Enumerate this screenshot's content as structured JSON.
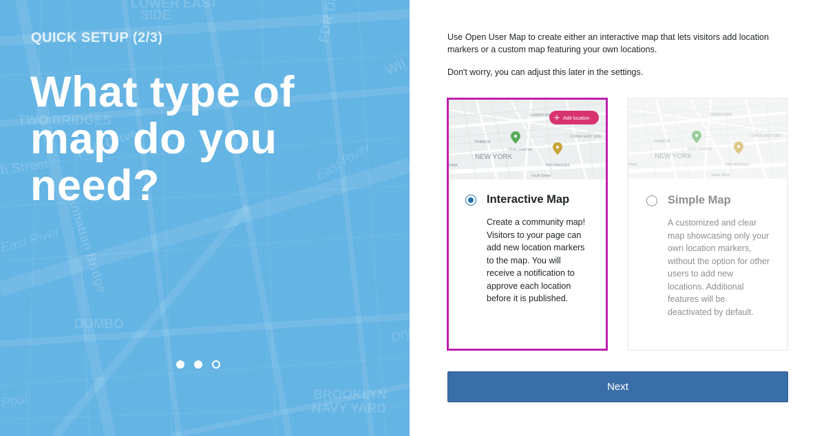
{
  "left_panel": {
    "step": "QUICK SETUP (2/3)",
    "question": "What type of map do you need?",
    "background_labels": [
      "LOWER EAST",
      "SIDE",
      "FDR Drive",
      "Wil",
      "TWO BRIDGES",
      "h Street",
      "FDR Drive",
      "East River",
      "East River",
      "Manhattan Bridge",
      "DUMBO",
      "BROOKLYN",
      "NAVY YARD",
      "Pool",
      "Dry"
    ],
    "pagination": {
      "total": 3,
      "active": 2
    }
  },
  "intro": {
    "line1": "Use Open User Map to create either an interactive map that lets visitors add location markers or a custom map featuring your own locations.",
    "line2": "Don't worry, you can adjust this later in the settings."
  },
  "options": [
    {
      "title": "Interactive Map",
      "description": "Create a community map! Visitors to your page can add new location markers to the map. You will receive a notification to approve each location before it is published.",
      "selected": true,
      "thumbnail": {
        "add_button": "Add location",
        "labels": [
          "TRIBECA",
          "CHINATOWN",
          "LOWER EAST SIDE",
          "CIVIC CENTER",
          "NEW YORK",
          "TWO BRIDGES",
          "PARK",
          "South Street"
        ]
      }
    },
    {
      "title": "Simple Map",
      "description": "A customized and clear map showcasing only your own location markers, without the option for other users to add new locations. Additional features will be deactivated by default.",
      "selected": false,
      "thumbnail": {
        "labels": [
          "TRIBECA",
          "CHINATOWN",
          "LOWER EAST SIDE",
          "CIVIC CENTER",
          "NEW YORK",
          "TWO BRIDGES",
          "PARK",
          "South Street"
        ]
      }
    }
  ],
  "next_label": "Next",
  "colors": {
    "left_bg": "#64b4e4",
    "selected_border": "#c01fae",
    "button_bg": "#3a6ea8",
    "radio_active": "#2271b1",
    "add_button": "#d8336f",
    "pin_green": "#5bab5a",
    "pin_gold": "#c9a43a"
  }
}
